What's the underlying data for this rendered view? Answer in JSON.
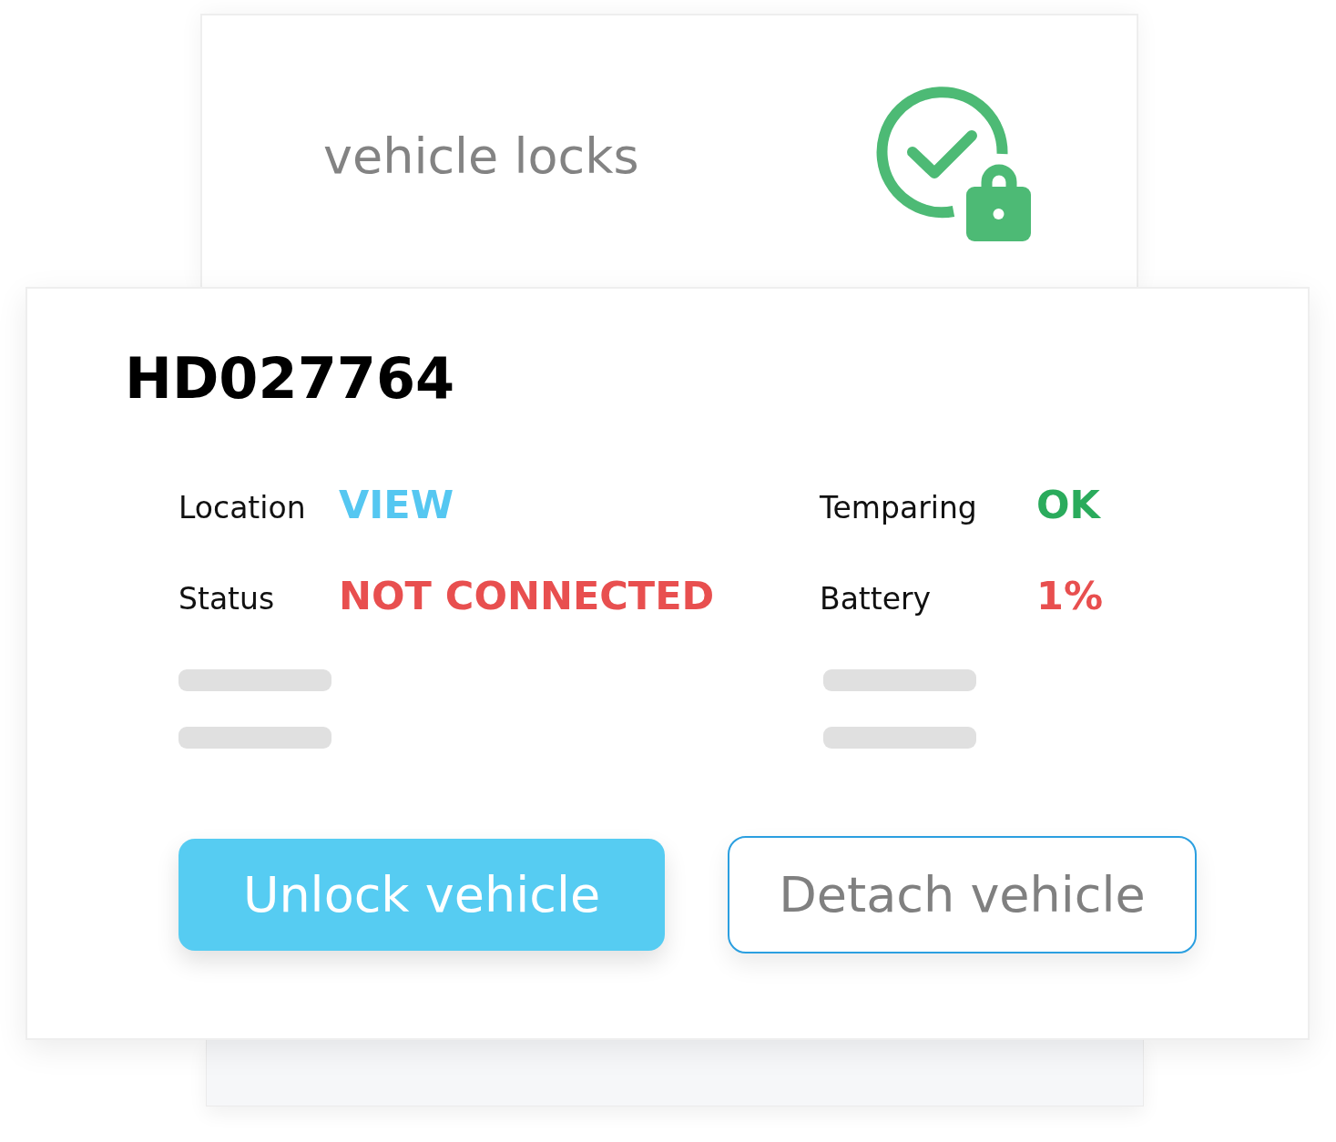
{
  "lock_card": {
    "title": "vehicle locks"
  },
  "vehicle": {
    "id": "HD027764",
    "fields": [
      {
        "label": "Location",
        "value": "VIEW",
        "kind": "link"
      },
      {
        "label": "Temparing",
        "value": "OK",
        "kind": "ok"
      },
      {
        "label": "Status",
        "value": "NOT CONNECTED",
        "kind": "alert"
      },
      {
        "label": "Battery",
        "value": "1%",
        "kind": "alert"
      }
    ],
    "buttons": [
      {
        "label": "Unlock vehicle",
        "kind": "primary"
      },
      {
        "label": "Detach vehicle",
        "kind": "secondary"
      }
    ]
  }
}
